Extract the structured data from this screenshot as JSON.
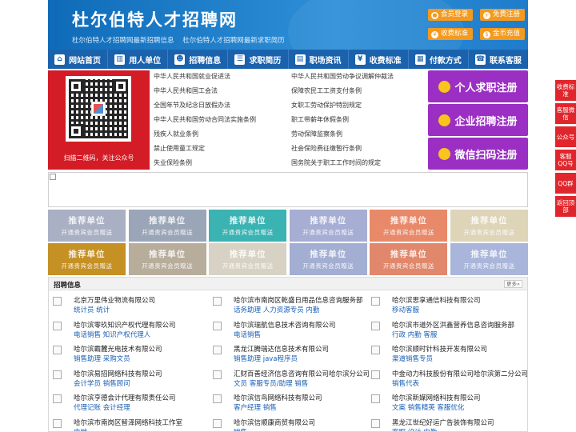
{
  "header": {
    "title": "杜尔伯特人才招聘网",
    "subtitles": [
      "杜尔伯特人才招聘网最新招聘信息",
      "杜尔伯特人才招聘网最新求职简历"
    ],
    "buttons": {
      "login": "会员登录",
      "register": "免费注册",
      "pricing": "收费标准",
      "recharge": "金币充值"
    }
  },
  "nav": [
    {
      "label": "网站首页",
      "icon": "home-icon"
    },
    {
      "label": "用人单位",
      "icon": "building-icon"
    },
    {
      "label": "招聘信息",
      "icon": "recruit-icon"
    },
    {
      "label": "求职简历",
      "icon": "resume-icon"
    },
    {
      "label": "职场资讯",
      "icon": "news-icon"
    },
    {
      "label": "收费标准",
      "icon": "price-icon"
    },
    {
      "label": "付款方式",
      "icon": "payment-icon"
    },
    {
      "label": "联系客服",
      "icon": "service-icon"
    }
  ],
  "qr": {
    "caption": "扫描二维码，关注公众号"
  },
  "laws": {
    "left": [
      "中华人民共和国就业促进法",
      "中华人民共和国工会法",
      "全国年节及纪念日放假办法",
      "中华人民共和国劳动合同法实施条例",
      "残疾人就业条例",
      "禁止使用童工规定",
      "失业保险条例"
    ],
    "right": [
      "中华人民共和国劳动争议调解仲裁法",
      "保障农民工工资支付条例",
      "女职工劳动保护特别规定",
      "职工带薪年休假条例",
      "劳动保障监察条例",
      "社会保险费征缴暂行条例",
      "国务院关于职工工作时间的规定"
    ]
  },
  "register_buttons": [
    {
      "label": "个人求职注册"
    },
    {
      "label": "企业招聘注册"
    },
    {
      "label": "微信扫码注册"
    }
  ],
  "tiles": {
    "title": "推荐单位",
    "subtitle": "开通贵宾会员赠送",
    "colors": [
      "#aab0c4",
      "#9aa6b8",
      "#3bb3b3",
      "#a7aed4",
      "#e8896a",
      "#ded4b8",
      "#c59024",
      "#b7ad9a",
      "#d7d2c4",
      "#a2aed2",
      "#e1876b",
      "#a9b5da"
    ]
  },
  "jobs": {
    "heading": "招聘信息",
    "more": "更多»",
    "columns": [
      [
        {
          "company": "北京万里伟业物流有限公司",
          "positions": "统计员 统计"
        },
        {
          "company": "哈尔滨零玖知识产权代理有限公司",
          "positions": "电话销售 知识产权代理人"
        },
        {
          "company": "哈尔滨霸麓光电技术有限公司",
          "positions": "销售助理 采购文员"
        },
        {
          "company": "哈尔滨易招网络科技有限公司",
          "positions": "会计学员 销售顾问"
        },
        {
          "company": "哈尔滨亨德会计代理有限责任公司",
          "positions": "代理记账 会计经理"
        },
        {
          "company": "哈尔滨市南岗区智泽网络科技工作室",
          "positions": "电销"
        }
      ],
      [
        {
          "company": "哈尔滨市南岗区乾盛日用品信息咨询服务部",
          "positions": "话务助理 人力资源专员 内勤"
        },
        {
          "company": "哈尔滨瑞航信息技术咨询有限公司",
          "positions": "电话销售"
        },
        {
          "company": "黑龙江腾瑞达信息技术有限公司",
          "positions": "销售助理 java程序员"
        },
        {
          "company": "汇财百善经济信息咨询有限公司哈尔滨分公司",
          "positions": "文员 客服专员/助理 销售"
        },
        {
          "company": "哈尔滨信鸟网络科技有限公司",
          "positions": "客户经理 销售"
        },
        {
          "company": "哈尔滨信顺康商贸有限公司",
          "positions": "销售"
        }
      ],
      [
        {
          "company": "哈尔滨思享通信科技有限公司",
          "positions": "移动客服"
        },
        {
          "company": "哈尔滨市道外区洪鑫营养信息咨询服务部",
          "positions": "行政 内勤 客服"
        },
        {
          "company": "哈尔滨顺时针科技开发有限公司",
          "positions": "渠道销售专员"
        },
        {
          "company": "中金动力科技股份有限公司哈尔滨第二分公司",
          "positions": "销售代表"
        },
        {
          "company": "哈尔滨新媒网络科技有限公司",
          "positions": "文案 销售精英 客服优化"
        },
        {
          "company": "黑龙江世纪好运广告装饰有限公司",
          "positions": "客服 设计 内勤"
        }
      ]
    ]
  },
  "side": [
    "收费标准",
    "客服微信",
    "公众号",
    "客服QQ号",
    "QQ群",
    "返回顶部"
  ]
}
